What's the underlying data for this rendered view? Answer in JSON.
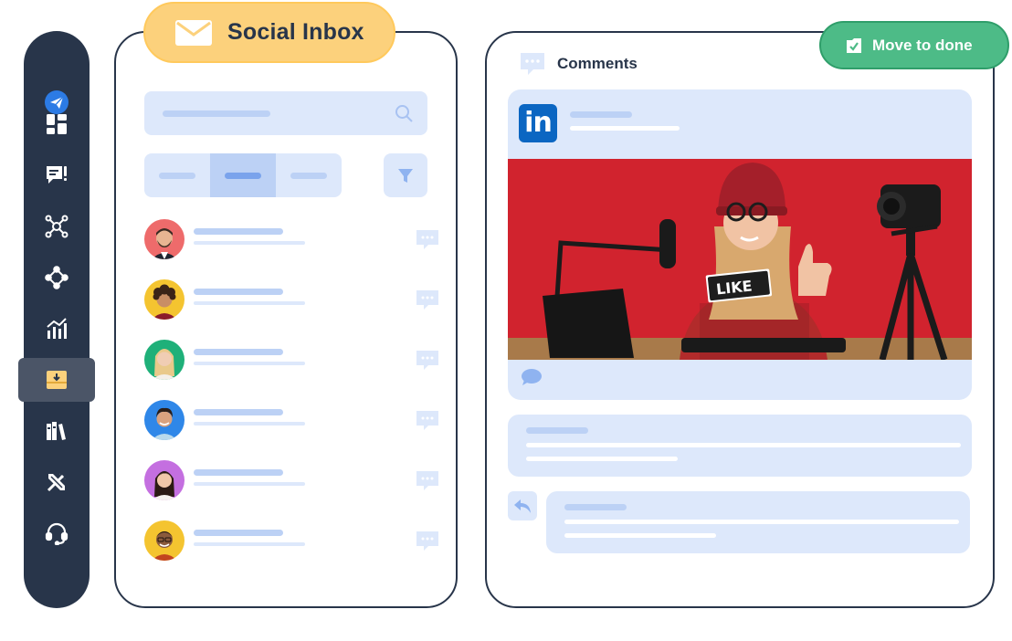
{
  "inbox": {
    "title": "Social Inbox",
    "envelope_icon": "envelope-icon",
    "search_icon": "search-icon",
    "filter_icon": "filter-icon",
    "tabs": [
      "",
      "",
      ""
    ],
    "active_tab_index": 1,
    "contacts_count_shown": 6
  },
  "sidebar": {
    "items": [
      {
        "icon": "send-logo-icon"
      },
      {
        "icon": "dashboard-icon"
      },
      {
        "icon": "compose-icon"
      },
      {
        "icon": "network-icon"
      },
      {
        "icon": "hub-icon"
      },
      {
        "icon": "analytics-icon"
      },
      {
        "icon": "inbox-icon",
        "active": true
      },
      {
        "icon": "library-icon"
      },
      {
        "icon": "tools-icon"
      },
      {
        "icon": "support-headset-icon"
      }
    ]
  },
  "comments": {
    "title": "Comments",
    "move_to_done_label": "Move to done",
    "post": {
      "network": "linkedin",
      "logo_text": "in",
      "image_sign_text": "LIKE"
    }
  },
  "colors": {
    "sidebar_bg": "#28354a",
    "accent_yellow": "#fcd17c",
    "accent_green": "#4dbb87",
    "linkedin_blue": "#0b66c2",
    "skeleton_light": "#dde8fb",
    "skeleton_mid": "#bcd1f5",
    "photo_bg": "#d1232e"
  }
}
